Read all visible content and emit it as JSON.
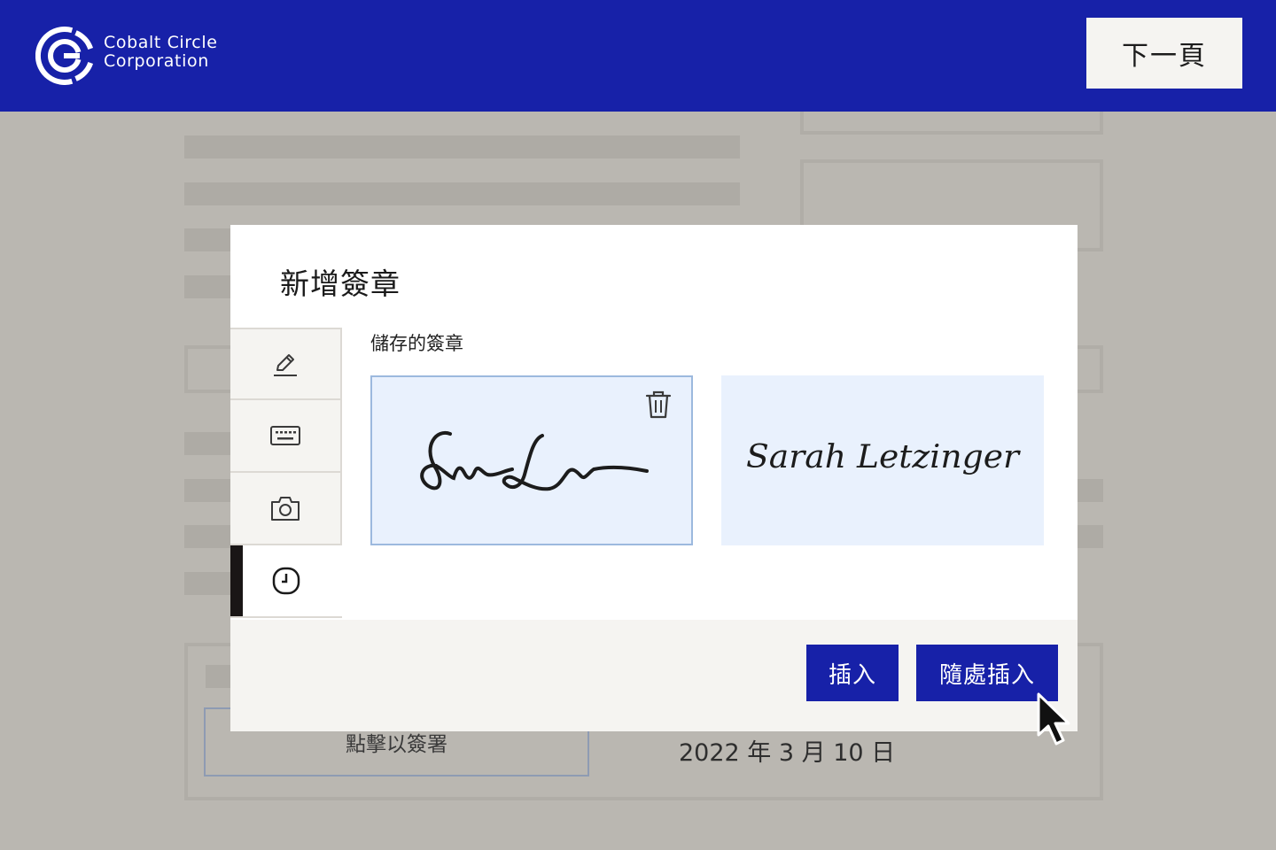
{
  "header": {
    "company_line1": "Cobalt Circle",
    "company_line2": "Corporation",
    "next_button": "下一頁",
    "logo_icon": "cobalt-circle-logo",
    "background_color": "#1721a8"
  },
  "document": {
    "sign_field_label": "點擊以簽署",
    "date_text": "2022 年 3 月 10 日"
  },
  "modal": {
    "title": "新增簽章",
    "tabs": [
      {
        "icon": "pen-icon",
        "active": false
      },
      {
        "icon": "keyboard-icon",
        "active": false
      },
      {
        "icon": "camera-icon",
        "active": false
      },
      {
        "icon": "clock-icon",
        "active": true
      }
    ],
    "saved_label": "儲存的簽章",
    "signatures": [
      {
        "kind": "initials-drawn",
        "selected": true,
        "delete_icon": "trash-icon"
      },
      {
        "kind": "full-name-script",
        "text": "Sarah Letzinger",
        "selected": false
      }
    ],
    "buttons": {
      "insert": "插入",
      "insert_anywhere": "隨處插入"
    }
  },
  "colors": {
    "primary": "#1721a8",
    "card_bg": "#e9f1fd",
    "card_border": "#9cb9de",
    "page_overlay": "#bab7b1"
  }
}
